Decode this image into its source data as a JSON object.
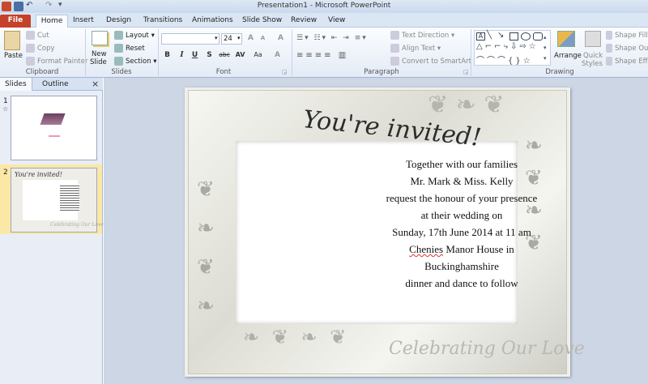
{
  "window": {
    "title": "Presentation1 - Microsoft PowerPoint"
  },
  "tabs": [
    "File",
    "Home",
    "Insert",
    "Design",
    "Transitions",
    "Animations",
    "Slide Show",
    "Review",
    "View"
  ],
  "ribbon": {
    "clipboard": {
      "paste": "Paste",
      "cut": "Cut",
      "copy": "Copy",
      "format_painter": "Format Painter",
      "label": "Clipboard"
    },
    "slides": {
      "new_slide": "New",
      "new_slide2": "Slide",
      "layout": "Layout",
      "reset": "Reset",
      "section": "Section",
      "label": "Slides"
    },
    "font": {
      "font_name": "",
      "font_size": "24",
      "bold": "B",
      "italic": "I",
      "underline": "U",
      "shadow": "S",
      "strike": "abc",
      "spacing": "AV",
      "case": "Aa",
      "color": "A",
      "grow": "A",
      "shrink": "A",
      "clear": "A",
      "label": "Font"
    },
    "paragraph": {
      "text_direction": "Text Direction",
      "align_text": "Align Text",
      "convert_smartart": "Convert to SmartArt",
      "label": "Paragraph"
    },
    "drawing": {
      "arrange": "Arrange",
      "quick_styles": "Quick",
      "quick_styles2": "Styles",
      "shape_fill": "Shape Fill",
      "shape_outline": "Shape Out",
      "shape_effects": "Shape Effe",
      "label": "Drawing"
    }
  },
  "left_pane": {
    "tabs": [
      "Slides",
      "Outline"
    ],
    "close": "×",
    "slides": [
      {
        "number": "1",
        "star": "☆"
      },
      {
        "number": "2",
        "thumb_heading": "You're invited!",
        "thumb_footer": "Celebrating Our Love"
      }
    ]
  },
  "slide": {
    "heading": "You're invited!",
    "lines": [
      "Together with our families",
      "Mr. Mark & Miss. Kelly",
      "request the honour of your presence",
      "at their wedding  on",
      "Sunday, 17th June 2014 at 11 am"
    ],
    "line6_word": "Chenies",
    "line6_rest": " Manor House in",
    "line7": "Buckinghamshire",
    "line8": "dinner and dance to follow",
    "footer": "Celebrating Our Love"
  }
}
